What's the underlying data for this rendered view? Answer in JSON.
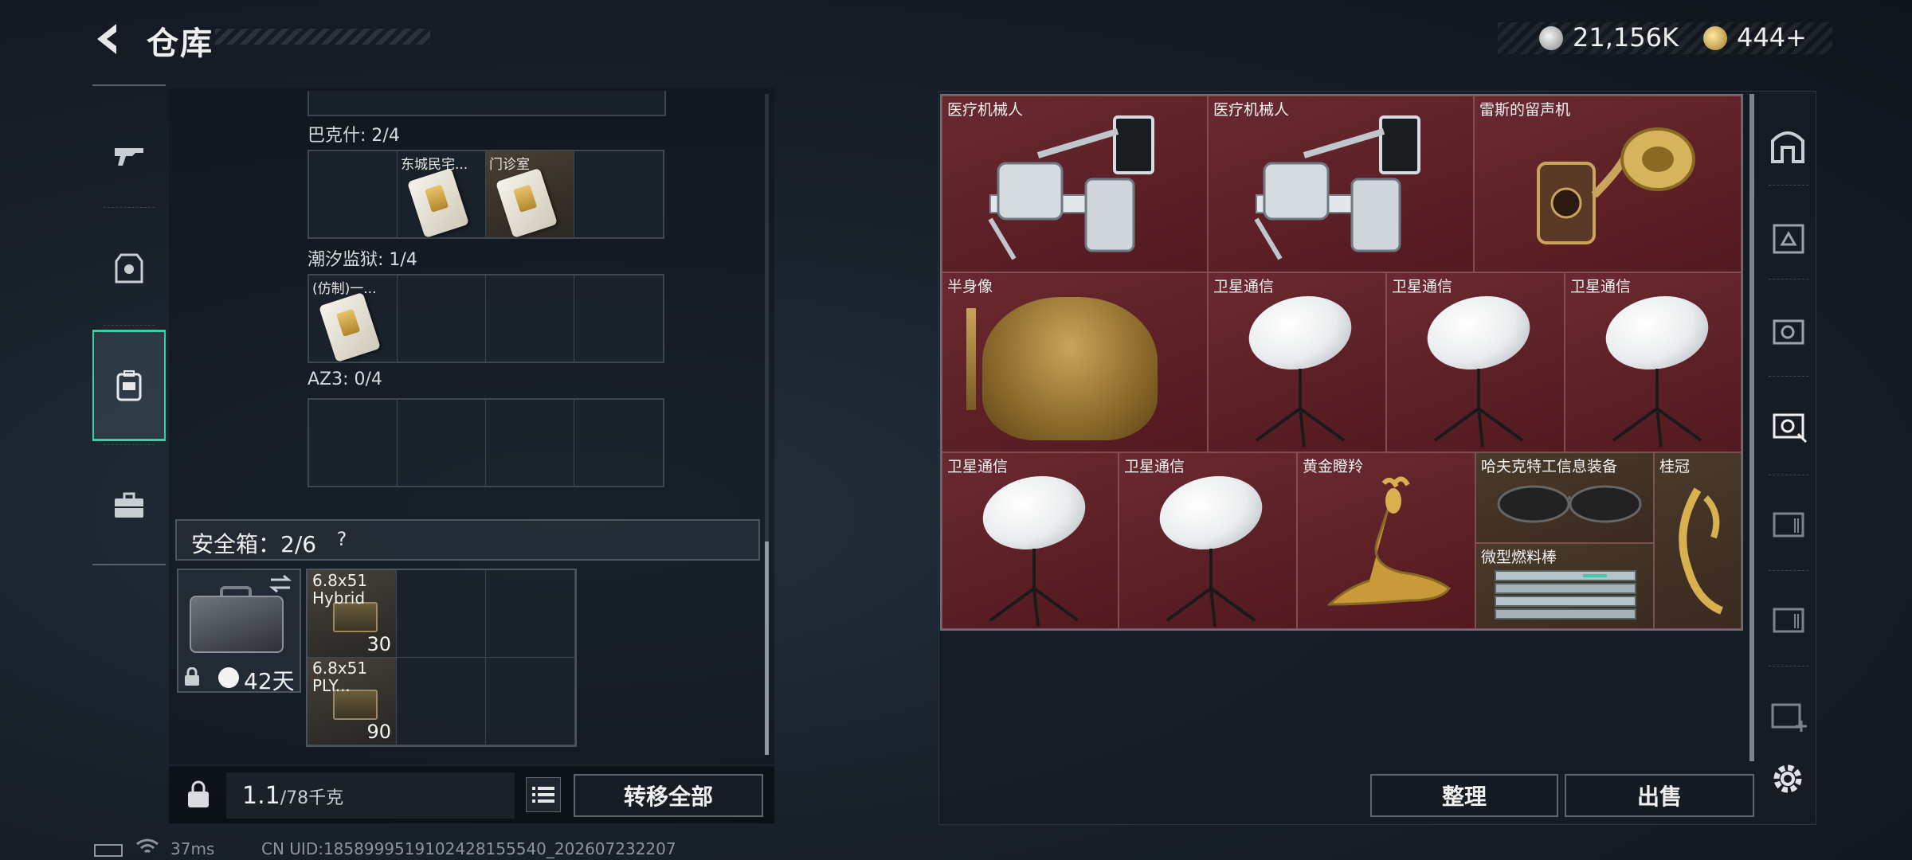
{
  "header": {
    "title": "仓库",
    "coins": "21,156K",
    "gems": "444",
    "gems_plus": "+"
  },
  "left_rail": {
    "tabs": [
      {
        "icon": "gun-icon"
      },
      {
        "icon": "armor-icon"
      },
      {
        "icon": "backpack-icon",
        "active": true
      },
      {
        "icon": "toolbox-icon"
      }
    ]
  },
  "key_groups": [
    {
      "label": "巴克什: 2/4",
      "slots": [
        "",
        "东城民宅...",
        "门诊室",
        ""
      ]
    },
    {
      "label": "潮汐监狱: 1/4",
      "slots": [
        "(仿制)一...",
        "",
        "",
        ""
      ]
    },
    {
      "label": "AZ3: 0/4",
      "slots": [
        "",
        "",
        "",
        ""
      ]
    }
  ],
  "safebox": {
    "label": "安全箱：2/6",
    "help": "?",
    "days": "42天",
    "ammo": [
      {
        "name": "6.8x51 Hybrid",
        "count": "30"
      },
      {
        "name": "6.8x51 PLY...",
        "count": "90"
      }
    ]
  },
  "footer": {
    "weight_value": "1.1",
    "weight_max": "/78千克",
    "transfer_all": "转移全部",
    "sort": "整理",
    "sell": "出售"
  },
  "storage_items": [
    {
      "name": "医疗机械人"
    },
    {
      "name": "医疗机械人"
    },
    {
      "name": "雷斯的留声机"
    },
    {
      "name": "半身像"
    },
    {
      "name": "卫星通信"
    },
    {
      "name": "卫星通信"
    },
    {
      "name": "卫星通信"
    },
    {
      "name": "卫星通信"
    },
    {
      "name": "卫星通信"
    },
    {
      "name": "黄金瞪羚"
    },
    {
      "name": "哈夫克特工信息装备"
    },
    {
      "name": "桂冠"
    },
    {
      "name": "微型燃料棒"
    }
  ],
  "status": {
    "ping": "37ms",
    "uid": "CN UID:1858999519102428155540_202607232207"
  },
  "colors": {
    "accent": "#3ad0a6",
    "item_red": "#5c1f24"
  }
}
